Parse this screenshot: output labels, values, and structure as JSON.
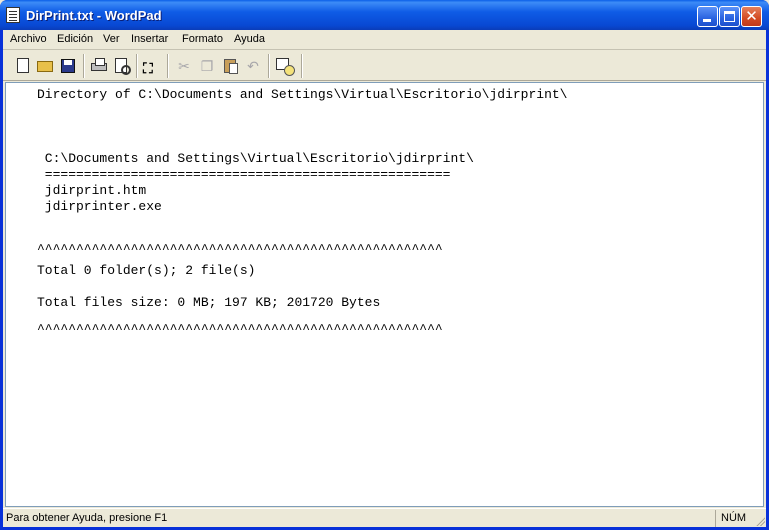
{
  "window": {
    "title": "DirPrint.txt - WordPad"
  },
  "menu": {
    "items": [
      "Archivo",
      "Edición",
      "Ver",
      "Insertar",
      "Formato",
      "Ayuda"
    ]
  },
  "toolbar": {
    "icons": [
      "new-icon",
      "open-icon",
      "save-icon",
      "print-icon",
      "print-preview-icon",
      "find-icon",
      "cut-icon",
      "copy-icon",
      "paste-icon",
      "undo-icon",
      "date-time-icon"
    ],
    "disabled": [
      "cut-icon",
      "copy-icon",
      "undo-icon"
    ]
  },
  "document": {
    "lines": [
      "Directory of C:\\Documents and Settings\\Virtual\\Escritorio\\jdirprint\\",
      " C:\\Documents and Settings\\Virtual\\Escritorio\\jdirprint\\",
      " ====================================================",
      " jdirprint.htm",
      " jdirprinter.exe",
      "^^^^^^^^^^^^^^^^^^^^^^^^^^^^^^^^^^^^^^^^^^^^^^^^^^^^",
      "Total 0 folder(s); 2 file(s)",
      "Total files size: 0 MB; 197 KB; 201720 Bytes",
      "^^^^^^^^^^^^^^^^^^^^^^^^^^^^^^^^^^^^^^^^^^^^^^^^^^^^"
    ]
  },
  "status": {
    "help_text": "Para obtener Ayuda, presione F1",
    "num_indicator": "NÚM"
  }
}
